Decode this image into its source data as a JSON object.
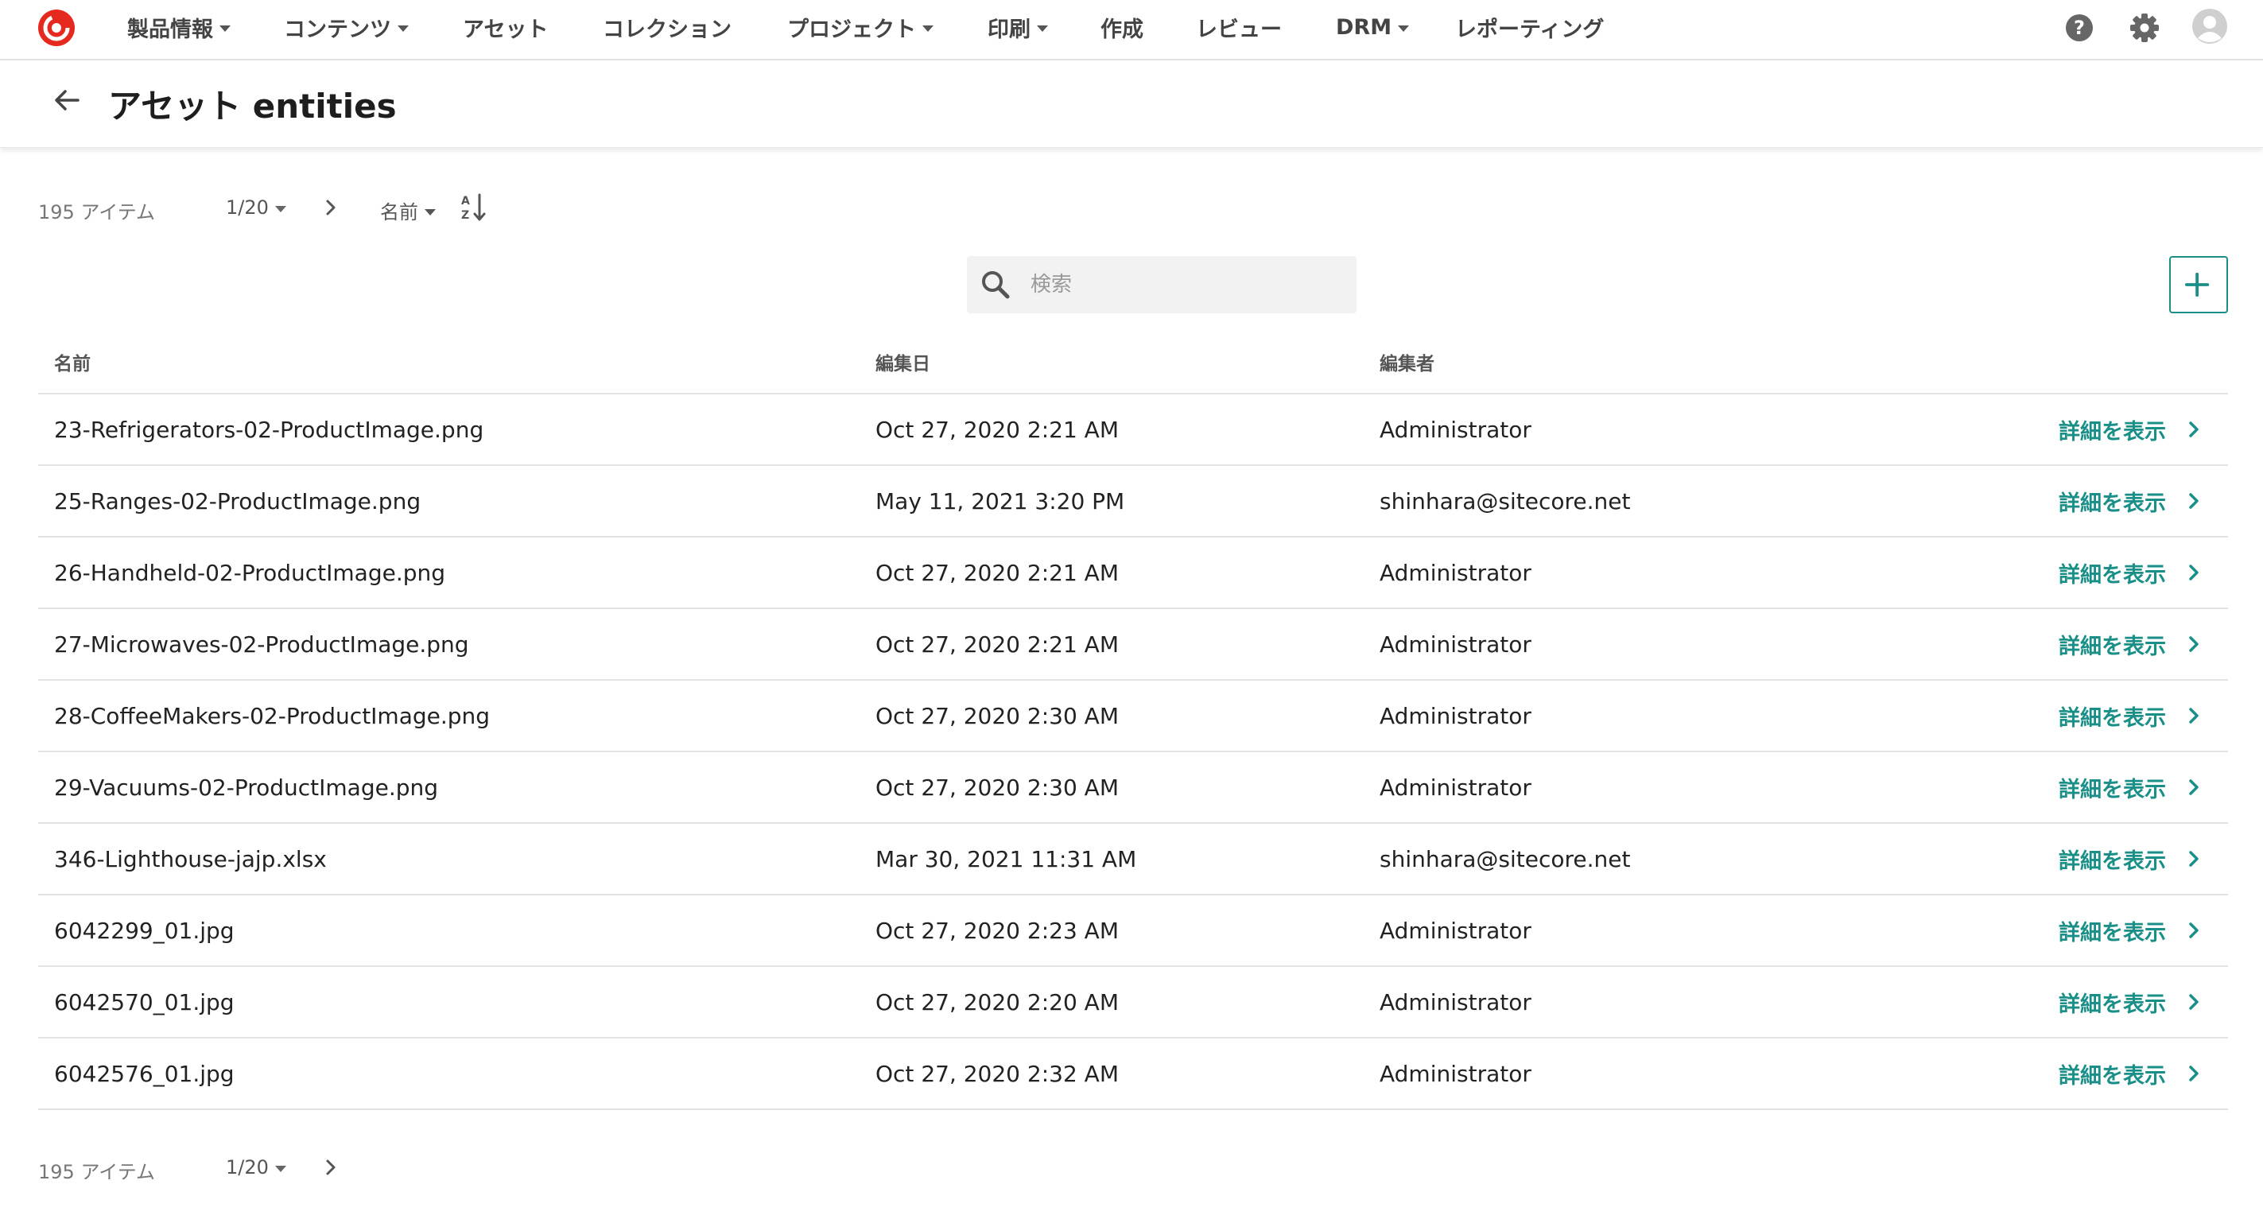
{
  "nav": {
    "items": [
      {
        "label": "製品情報",
        "dropdown": true
      },
      {
        "label": "コンテンツ",
        "dropdown": true
      },
      {
        "label": "アセット",
        "dropdown": false
      },
      {
        "label": "コレクション",
        "dropdown": false
      },
      {
        "label": "プロジェクト",
        "dropdown": true
      },
      {
        "label": "印刷",
        "dropdown": true
      },
      {
        "label": "作成",
        "dropdown": false
      },
      {
        "label": "レビュー",
        "dropdown": false
      },
      {
        "label": "DRM",
        "dropdown": true
      },
      {
        "label": "レポーティング",
        "dropdown": false
      }
    ],
    "icons": [
      "help-icon",
      "settings-icon",
      "user-avatar-icon"
    ]
  },
  "header": {
    "title": "アセット entities"
  },
  "toolbar": {
    "count": "195 アイテム",
    "page": "1/20",
    "sort_label": "名前"
  },
  "search": {
    "placeholder": "検索"
  },
  "table": {
    "columns": [
      "名前",
      "編集日",
      "編集者"
    ],
    "details_label": "詳細を表示",
    "rows": [
      {
        "name": "23-Refrigerators-02-ProductImage.png",
        "date": "Oct 27, 2020 2:21 AM",
        "editor": "Administrator"
      },
      {
        "name": "25-Ranges-02-ProductImage.png",
        "date": "May 11, 2021 3:20 PM",
        "editor": "shinhara@sitecore.net"
      },
      {
        "name": "26-Handheld-02-ProductImage.png",
        "date": "Oct 27, 2020 2:21 AM",
        "editor": "Administrator"
      },
      {
        "name": "27-Microwaves-02-ProductImage.png",
        "date": "Oct 27, 2020 2:21 AM",
        "editor": "Administrator"
      },
      {
        "name": "28-CoffeeMakers-02-ProductImage.png",
        "date": "Oct 27, 2020 2:30 AM",
        "editor": "Administrator"
      },
      {
        "name": "29-Vacuums-02-ProductImage.png",
        "date": "Oct 27, 2020 2:30 AM",
        "editor": "Administrator"
      },
      {
        "name": "346-Lighthouse-jajp.xlsx",
        "date": "Mar 30, 2021 11:31 AM",
        "editor": "shinhara@sitecore.net"
      },
      {
        "name": "6042299_01.jpg",
        "date": "Oct 27, 2020 2:23 AM",
        "editor": "Administrator"
      },
      {
        "name": "6042570_01.jpg",
        "date": "Oct 27, 2020 2:20 AM",
        "editor": "Administrator"
      },
      {
        "name": "6042576_01.jpg",
        "date": "Oct 27, 2020 2:32 AM",
        "editor": "Administrator"
      }
    ]
  },
  "footer": {
    "count": "195 アイテム",
    "page": "1/20"
  },
  "colors": {
    "accent": "#1a8f88",
    "logo": "#e5291f",
    "divider": "#e3e3e3"
  }
}
